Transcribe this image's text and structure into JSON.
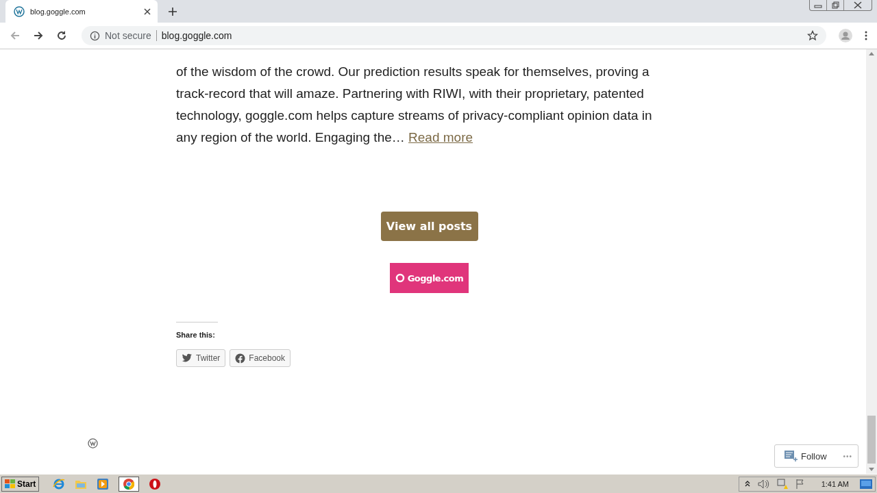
{
  "browser": {
    "tab": {
      "title": "blog.goggle.com",
      "selected": true
    },
    "security": "Not secure",
    "url": "blog.goggle.com"
  },
  "post": {
    "lines": [
      "of the wisdom of the crowd. Our prediction results speak for themselves, proving a",
      "track-record that will amaze. Partnering with RIWI, with their proprietary, patented",
      "technology, goggle.com helps capture streams of privacy-compliant opinion data in",
      "any region of the world. Engaging the…"
    ],
    "read_more": "Read more"
  },
  "view_all": "View all posts",
  "logo": "Goggle.com",
  "share": {
    "heading": "Share this:",
    "buttons": [
      {
        "kind": "twitter",
        "label": "Twitter"
      },
      {
        "kind": "facebook",
        "label": "Facebook"
      }
    ]
  },
  "follow": {
    "label": "Follow",
    "more": "•••"
  },
  "taskbar": {
    "start": "Start",
    "clock": "1:41 AM"
  }
}
